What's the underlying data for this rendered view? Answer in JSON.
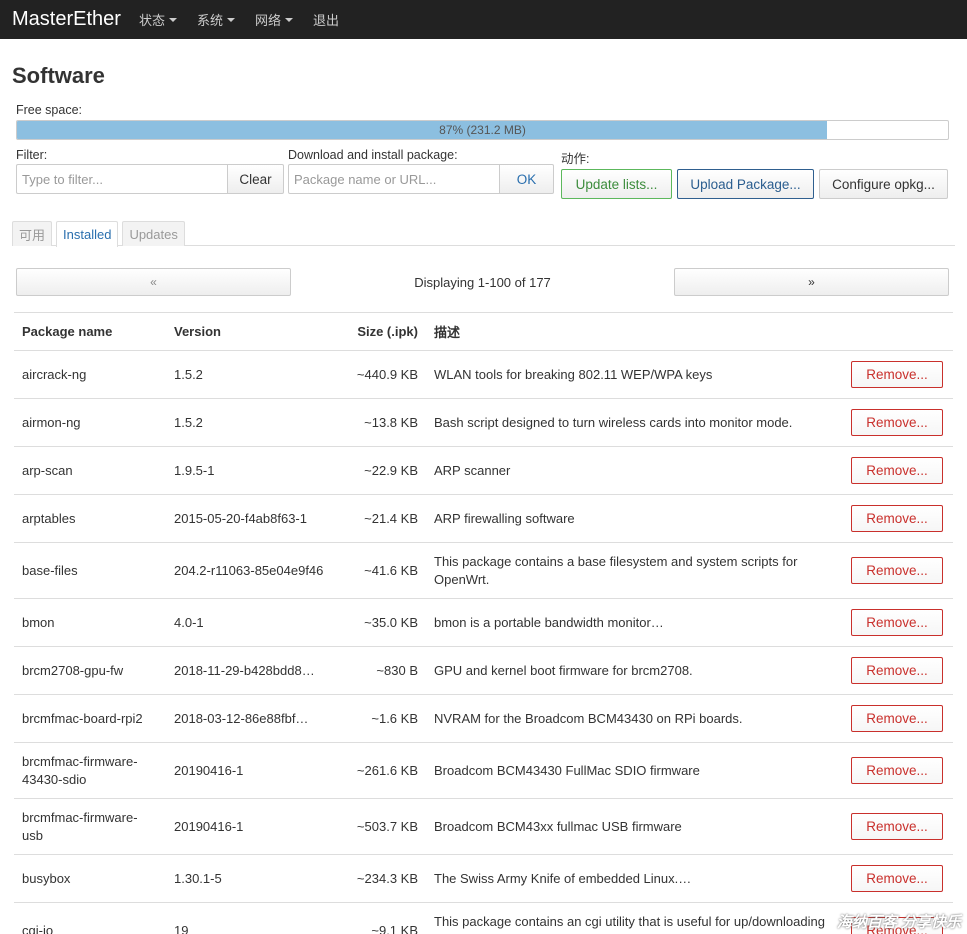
{
  "navbar": {
    "brand": "MasterEther",
    "menus": [
      "状态",
      "系统",
      "网络"
    ],
    "logout": "退出"
  },
  "page_title": "Software",
  "free_space": {
    "label": "Free space:",
    "percent": 87,
    "text": "87% (231.2 MB)"
  },
  "filter": {
    "label": "Filter:",
    "placeholder": "Type to filter...",
    "clear_label": "Clear"
  },
  "download": {
    "label": "Download and install package:",
    "placeholder": "Package name or URL...",
    "ok_label": "OK"
  },
  "actions": {
    "label": "动作:",
    "update_lists": "Update lists...",
    "upload_package": "Upload Package...",
    "configure_opkg": "Configure opkg..."
  },
  "tabs": [
    "可用",
    "Installed",
    "Updates"
  ],
  "active_tab": "Installed",
  "pager": {
    "prev": "«",
    "next": "»",
    "text": "Displaying 1-100 of 177"
  },
  "table": {
    "headers": [
      "Package name",
      "Version",
      "Size (.ipk)",
      "描述"
    ],
    "remove_label": "Remove...",
    "rows": [
      {
        "name": "aircrack-ng",
        "version": "1.5.2",
        "size": "~440.9 KB",
        "desc": "WLAN tools for breaking 802.11 WEP/WPA keys"
      },
      {
        "name": "airmon-ng",
        "version": "1.5.2",
        "size": "~13.8 KB",
        "desc": "Bash script designed to turn wireless cards into monitor mode."
      },
      {
        "name": "arp-scan",
        "version": "1.9.5-1",
        "size": "~22.9 KB",
        "desc": "ARP scanner"
      },
      {
        "name": "arptables",
        "version": "2015-05-20-f4ab8f63-1",
        "size": "~21.4 KB",
        "desc": "ARP firewalling software"
      },
      {
        "name": "base-files",
        "version": "204.2-r11063-85e04e9f46",
        "size": "~41.6 KB",
        "desc": "This package contains a base filesystem and system scripts for OpenWrt."
      },
      {
        "name": "bmon",
        "version": "4.0-1",
        "size": "~35.0 KB",
        "desc": "bmon is a portable bandwidth monitor…"
      },
      {
        "name": "brcm2708-gpu-fw",
        "version": "2018-11-29-b428bdd8…",
        "size": "~830 B",
        "desc": "GPU and kernel boot firmware for brcm2708."
      },
      {
        "name": "brcmfmac-board-rpi2",
        "version": "2018-03-12-86e88fbf…",
        "size": "~1.6 KB",
        "desc": "NVRAM for the Broadcom BCM43430 on RPi boards."
      },
      {
        "name": "brcmfmac-firmware-43430-sdio",
        "version": "20190416-1",
        "size": "~261.6 KB",
        "desc": "Broadcom BCM43430 FullMac SDIO firmware"
      },
      {
        "name": "brcmfmac-firmware-usb",
        "version": "20190416-1",
        "size": "~503.7 KB",
        "desc": "Broadcom BCM43xx fullmac USB firmware"
      },
      {
        "name": "busybox",
        "version": "1.30.1-5",
        "size": "~234.3 KB",
        "desc": "The Swiss Army Knife of embedded Linux.…"
      },
      {
        "name": "cgi-io",
        "version": "19",
        "size": "~9.1 KB",
        "desc": "This package contains an cgi utility that is useful for up/downloading files"
      }
    ]
  },
  "watermark": "海纳百客 分享快乐"
}
